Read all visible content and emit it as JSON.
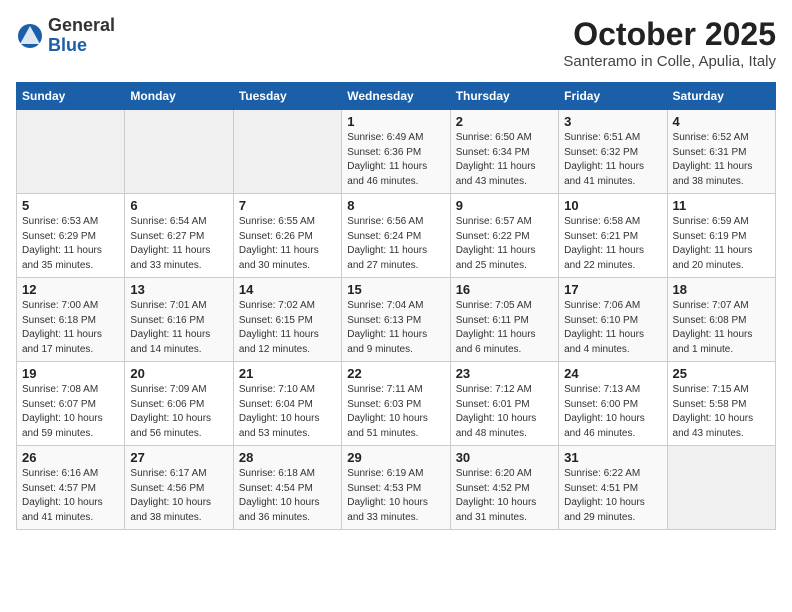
{
  "header": {
    "logo_general": "General",
    "logo_blue": "Blue",
    "month": "October 2025",
    "location": "Santeramo in Colle, Apulia, Italy"
  },
  "days_of_week": [
    "Sunday",
    "Monday",
    "Tuesday",
    "Wednesday",
    "Thursday",
    "Friday",
    "Saturday"
  ],
  "weeks": [
    [
      {
        "day": "",
        "info": ""
      },
      {
        "day": "",
        "info": ""
      },
      {
        "day": "",
        "info": ""
      },
      {
        "day": "1",
        "info": "Sunrise: 6:49 AM\nSunset: 6:36 PM\nDaylight: 11 hours\nand 46 minutes."
      },
      {
        "day": "2",
        "info": "Sunrise: 6:50 AM\nSunset: 6:34 PM\nDaylight: 11 hours\nand 43 minutes."
      },
      {
        "day": "3",
        "info": "Sunrise: 6:51 AM\nSunset: 6:32 PM\nDaylight: 11 hours\nand 41 minutes."
      },
      {
        "day": "4",
        "info": "Sunrise: 6:52 AM\nSunset: 6:31 PM\nDaylight: 11 hours\nand 38 minutes."
      }
    ],
    [
      {
        "day": "5",
        "info": "Sunrise: 6:53 AM\nSunset: 6:29 PM\nDaylight: 11 hours\nand 35 minutes."
      },
      {
        "day": "6",
        "info": "Sunrise: 6:54 AM\nSunset: 6:27 PM\nDaylight: 11 hours\nand 33 minutes."
      },
      {
        "day": "7",
        "info": "Sunrise: 6:55 AM\nSunset: 6:26 PM\nDaylight: 11 hours\nand 30 minutes."
      },
      {
        "day": "8",
        "info": "Sunrise: 6:56 AM\nSunset: 6:24 PM\nDaylight: 11 hours\nand 27 minutes."
      },
      {
        "day": "9",
        "info": "Sunrise: 6:57 AM\nSunset: 6:22 PM\nDaylight: 11 hours\nand 25 minutes."
      },
      {
        "day": "10",
        "info": "Sunrise: 6:58 AM\nSunset: 6:21 PM\nDaylight: 11 hours\nand 22 minutes."
      },
      {
        "day": "11",
        "info": "Sunrise: 6:59 AM\nSunset: 6:19 PM\nDaylight: 11 hours\nand 20 minutes."
      }
    ],
    [
      {
        "day": "12",
        "info": "Sunrise: 7:00 AM\nSunset: 6:18 PM\nDaylight: 11 hours\nand 17 minutes."
      },
      {
        "day": "13",
        "info": "Sunrise: 7:01 AM\nSunset: 6:16 PM\nDaylight: 11 hours\nand 14 minutes."
      },
      {
        "day": "14",
        "info": "Sunrise: 7:02 AM\nSunset: 6:15 PM\nDaylight: 11 hours\nand 12 minutes."
      },
      {
        "day": "15",
        "info": "Sunrise: 7:04 AM\nSunset: 6:13 PM\nDaylight: 11 hours\nand 9 minutes."
      },
      {
        "day": "16",
        "info": "Sunrise: 7:05 AM\nSunset: 6:11 PM\nDaylight: 11 hours\nand 6 minutes."
      },
      {
        "day": "17",
        "info": "Sunrise: 7:06 AM\nSunset: 6:10 PM\nDaylight: 11 hours\nand 4 minutes."
      },
      {
        "day": "18",
        "info": "Sunrise: 7:07 AM\nSunset: 6:08 PM\nDaylight: 11 hours\nand 1 minute."
      }
    ],
    [
      {
        "day": "19",
        "info": "Sunrise: 7:08 AM\nSunset: 6:07 PM\nDaylight: 10 hours\nand 59 minutes."
      },
      {
        "day": "20",
        "info": "Sunrise: 7:09 AM\nSunset: 6:06 PM\nDaylight: 10 hours\nand 56 minutes."
      },
      {
        "day": "21",
        "info": "Sunrise: 7:10 AM\nSunset: 6:04 PM\nDaylight: 10 hours\nand 53 minutes."
      },
      {
        "day": "22",
        "info": "Sunrise: 7:11 AM\nSunset: 6:03 PM\nDaylight: 10 hours\nand 51 minutes."
      },
      {
        "day": "23",
        "info": "Sunrise: 7:12 AM\nSunset: 6:01 PM\nDaylight: 10 hours\nand 48 minutes."
      },
      {
        "day": "24",
        "info": "Sunrise: 7:13 AM\nSunset: 6:00 PM\nDaylight: 10 hours\nand 46 minutes."
      },
      {
        "day": "25",
        "info": "Sunrise: 7:15 AM\nSunset: 5:58 PM\nDaylight: 10 hours\nand 43 minutes."
      }
    ],
    [
      {
        "day": "26",
        "info": "Sunrise: 6:16 AM\nSunset: 4:57 PM\nDaylight: 10 hours\nand 41 minutes."
      },
      {
        "day": "27",
        "info": "Sunrise: 6:17 AM\nSunset: 4:56 PM\nDaylight: 10 hours\nand 38 minutes."
      },
      {
        "day": "28",
        "info": "Sunrise: 6:18 AM\nSunset: 4:54 PM\nDaylight: 10 hours\nand 36 minutes."
      },
      {
        "day": "29",
        "info": "Sunrise: 6:19 AM\nSunset: 4:53 PM\nDaylight: 10 hours\nand 33 minutes."
      },
      {
        "day": "30",
        "info": "Sunrise: 6:20 AM\nSunset: 4:52 PM\nDaylight: 10 hours\nand 31 minutes."
      },
      {
        "day": "31",
        "info": "Sunrise: 6:22 AM\nSunset: 4:51 PM\nDaylight: 10 hours\nand 29 minutes."
      },
      {
        "day": "",
        "info": ""
      }
    ]
  ]
}
